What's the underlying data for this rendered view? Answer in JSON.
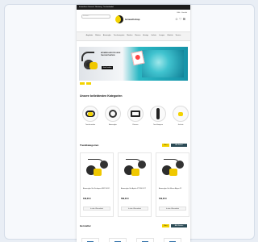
{
  "topbar": {
    "text": "Kostenloser Versand · Beratung · Taucherbedarf"
  },
  "header": {
    "search_placeholder": "Suchen...",
    "logo_text": "la tauchshop",
    "util_links": "Hilfe · Kontakt",
    "icons": [
      "user-icon",
      "heart-icon",
      "cart-icon"
    ]
  },
  "nav": {
    "items": [
      "Angebote",
      "Marken",
      "Atemregler",
      "Tauchcomputer",
      "Masken",
      "Flossen",
      "Anzüge",
      "Jackets",
      "Lampen",
      "Zubehör",
      "Service"
    ]
  },
  "banner": {
    "headline": "ATEMREGLER FÜR JEDE TAUCHSITUATION",
    "button": "Jetzt kaufen"
  },
  "categories": {
    "title": "Unsere beliebtesten Kategorien",
    "items": [
      {
        "label": "Tauchmasken",
        "icon": "mask-icon"
      },
      {
        "label": "Atemregler",
        "icon": "regulator-icon"
      },
      {
        "label": "Flossen",
        "icon": "fins-icon"
      },
      {
        "label": "Tauchlampen",
        "icon": "flashlight-icon"
      },
      {
        "label": "Jackets",
        "icon": "bcd-icon"
      }
    ]
  },
  "trends": {
    "title": "Trendkategorien",
    "pill_yellow": "Neu",
    "pill_dark": "Alle Artikel",
    "products": [
      {
        "name": "Atemregler-Set Scubapro MK25 EVO",
        "price": "649,00 €",
        "button": "In den Warenkorb"
      },
      {
        "name": "Atemregler-Set Apeks XTX50 DST",
        "price": "589,00 €",
        "button": "In den Warenkorb"
      },
      {
        "name": "Atemregler-Set Mares Abyss 22",
        "price": "529,00 €",
        "button": "In den Warenkorb"
      }
    ]
  },
  "brands": {
    "title": "Hersteller",
    "pill_yellow": "Neu",
    "pill_dark": "Alle Marken"
  },
  "colors": {
    "accent": "#f3d300",
    "dark": "#1c1c1c",
    "teal": "#2a4a55"
  }
}
